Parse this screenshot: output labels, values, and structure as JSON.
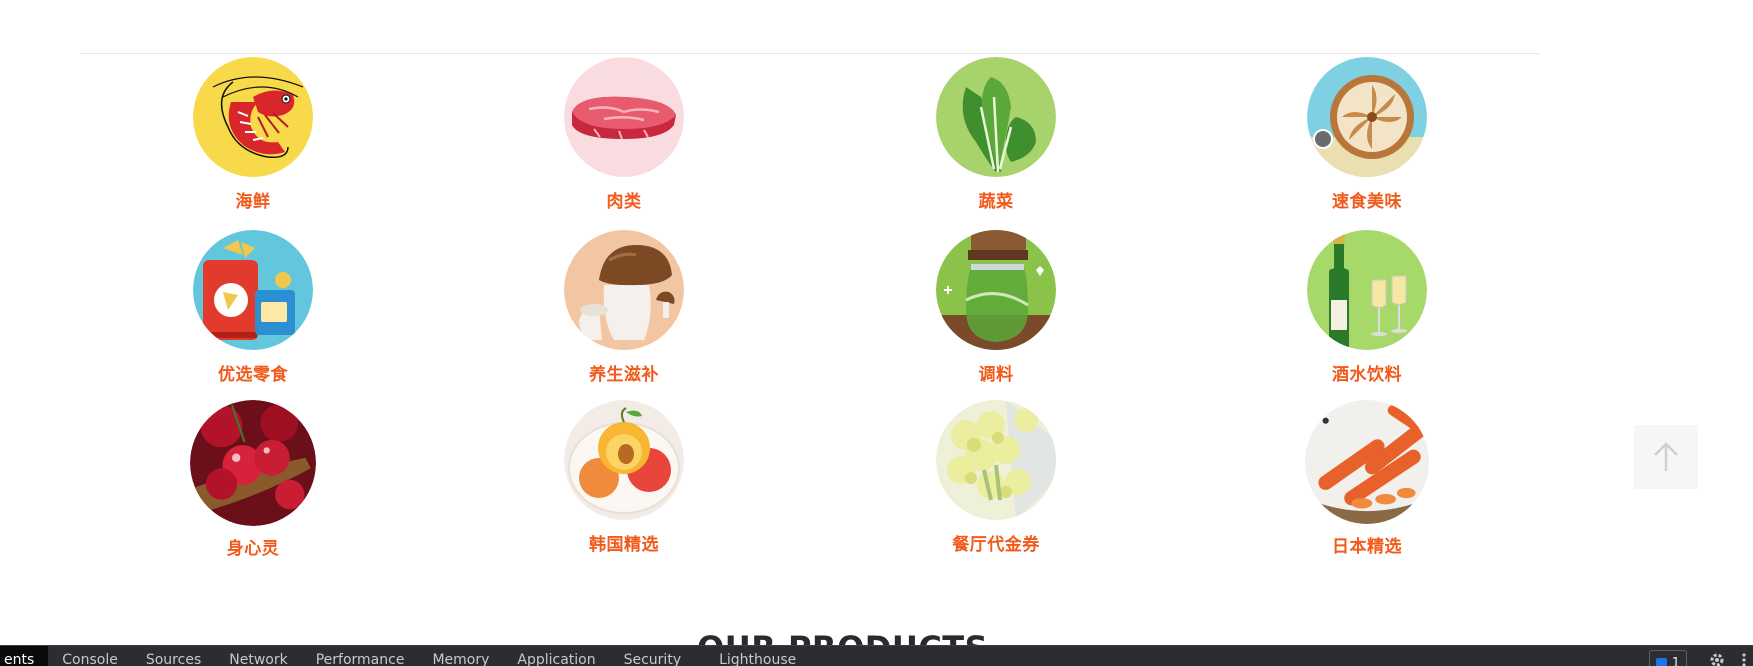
{
  "categories": [
    {
      "label": "海鲜",
      "icon": "shrimp-icon"
    },
    {
      "label": "肉类",
      "icon": "meat-icon"
    },
    {
      "label": "蔬菜",
      "icon": "cabbage-icon"
    },
    {
      "label": "速食美味",
      "icon": "pie-icon"
    },
    {
      "label": "优选零食",
      "icon": "snacks-icon"
    },
    {
      "label": "养生滋补",
      "icon": "mushroom-icon"
    },
    {
      "label": "调料",
      "icon": "pickle-jar-icon"
    },
    {
      "label": "酒水饮料",
      "icon": "champagne-icon"
    },
    {
      "label": "身心灵",
      "icon": "cherries-icon"
    },
    {
      "label": "韩国精选",
      "icon": "apricot-icon"
    },
    {
      "label": "餐厅代金券",
      "icon": "cauliflower-icon"
    },
    {
      "label": "日本精选",
      "icon": "carrots-icon"
    }
  ],
  "section_title": "OUR PRODUCTS",
  "devtools": {
    "tabs": [
      "ents",
      "Console",
      "Sources",
      "Network",
      "Performance",
      "Memory",
      "Application",
      "Security",
      "Lighthouse"
    ],
    "badge_count": "1"
  },
  "colors": {
    "label": "#f25a1b",
    "devtools_bg": "#2b2d31"
  }
}
